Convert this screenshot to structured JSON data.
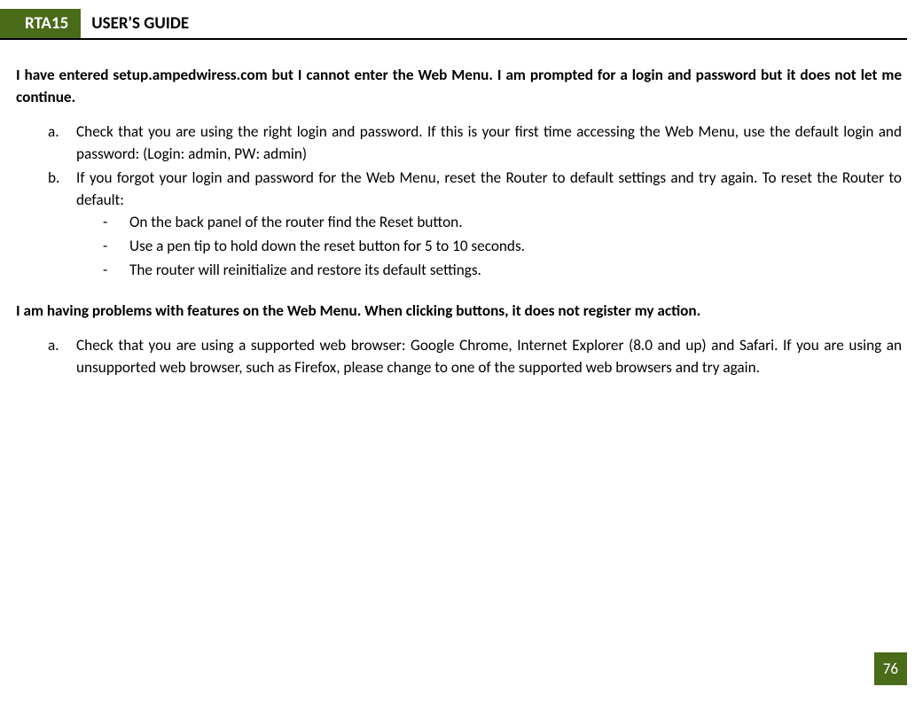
{
  "header": {
    "badge": "RTA15",
    "title": "USER'S GUIDE"
  },
  "section1": {
    "question": "I have entered setup.ampedwiress.com but I cannot enter the Web Menu.  I am prompted for a login and password but it does not let me continue.",
    "items": {
      "a": "Check that you are using the right login and password.  If this is your first time accessing the Web Menu, use the default login and password: (Login: admin, PW: admin)",
      "b": "If you forgot your login and password for the Web Menu, reset the Router to default settings and try again.  To reset the Router to default:",
      "b_sub": [
        "On the back panel of the router find the Reset button.",
        "Use a pen tip to hold down the reset button for 5 to 10 seconds.",
        "The router will reinitialize and restore its default settings."
      ]
    }
  },
  "section2": {
    "question": "I am having problems with features on the Web Menu.  When clicking buttons, it does not register my action.",
    "items": {
      "a": "Check that you are using a supported web browser: Google Chrome, Internet Explorer (8.0 and up) and Safari.  If you are using an unsupported web browser, such as Firefox, please change to one of the supported web browsers and try again."
    }
  },
  "pageNumber": "76"
}
